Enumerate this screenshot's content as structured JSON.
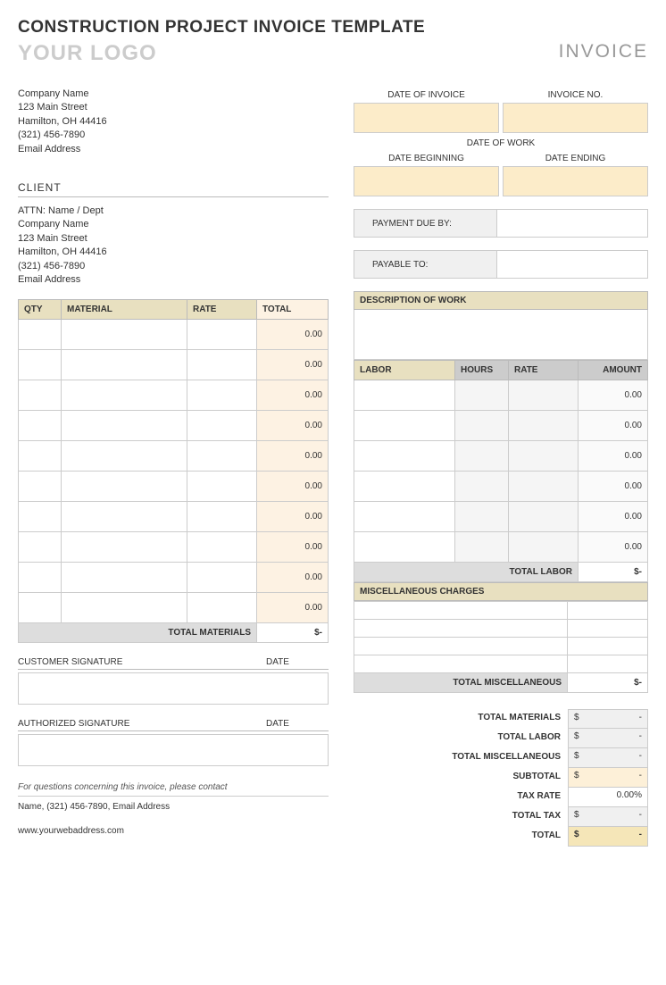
{
  "title": "CONSTRUCTION PROJECT INVOICE TEMPLATE",
  "logo": "YOUR LOGO",
  "invoiceLabel": "INVOICE",
  "company": {
    "name": "Company Name",
    "street": "123 Main Street",
    "city": "Hamilton, OH  44416",
    "phone": "(321) 456-7890",
    "email": "Email Address"
  },
  "clientHeader": "CLIENT",
  "client": {
    "attn": "ATTN: Name / Dept",
    "name": "Company Name",
    "street": "123 Main Street",
    "city": "Hamilton, OH  44416",
    "phone": "(321) 456-7890",
    "email": "Email Address"
  },
  "meta": {
    "dateOfInvoice": "DATE OF INVOICE",
    "invoiceNo": "INVOICE NO.",
    "dateOfWork": "DATE OF WORK",
    "dateBeginning": "DATE BEGINNING",
    "dateEnding": "DATE ENDING",
    "paymentDueBy": "PAYMENT DUE BY:",
    "payableTo": "PAYABLE TO:"
  },
  "materials": {
    "headers": {
      "qty": "QTY",
      "material": "MATERIAL",
      "rate": "RATE",
      "total": "TOTAL"
    },
    "rows": [
      "0.00",
      "0.00",
      "0.00",
      "0.00",
      "0.00",
      "0.00",
      "0.00",
      "0.00",
      "0.00",
      "0.00"
    ],
    "totalLabel": "TOTAL MATERIALS",
    "totalValue": {
      "sym": "$",
      "val": "-"
    }
  },
  "descHeader": "DESCRIPTION OF WORK",
  "labor": {
    "headers": {
      "labor": "LABOR",
      "hours": "HOURS",
      "rate": "RATE",
      "amount": "AMOUNT"
    },
    "rows": [
      "0.00",
      "0.00",
      "0.00",
      "0.00",
      "0.00",
      "0.00"
    ],
    "totalLabel": "TOTAL LABOR",
    "totalValue": {
      "sym": "$",
      "val": "-"
    }
  },
  "misc": {
    "header": "MISCELLANEOUS CHARGES",
    "rowCount": 4,
    "totalLabel": "TOTAL MISCELLANEOUS",
    "totalValue": {
      "sym": "$",
      "val": "-"
    }
  },
  "signatures": {
    "customer": "CUSTOMER SIGNATURE",
    "authorized": "AUTHORIZED SIGNATURE",
    "date": "DATE"
  },
  "summary": {
    "totalMaterials": {
      "label": "TOTAL MATERIALS",
      "sym": "$",
      "val": "-"
    },
    "totalLabor": {
      "label": "TOTAL LABOR",
      "sym": "$",
      "val": "-"
    },
    "totalMisc": {
      "label": "TOTAL MISCELLANEOUS",
      "sym": "$",
      "val": "-"
    },
    "subtotal": {
      "label": "SUBTOTAL",
      "sym": "$",
      "val": "-"
    },
    "taxRate": {
      "label": "TAX RATE",
      "val": "0.00%"
    },
    "totalTax": {
      "label": "TOTAL TAX",
      "sym": "$",
      "val": "-"
    },
    "total": {
      "label": "TOTAL",
      "sym": "$",
      "val": "-"
    }
  },
  "footer": {
    "note": "For questions concerning this invoice, please contact",
    "contact": "Name, (321) 456-7890, Email Address",
    "web": "www.yourwebaddress.com"
  }
}
